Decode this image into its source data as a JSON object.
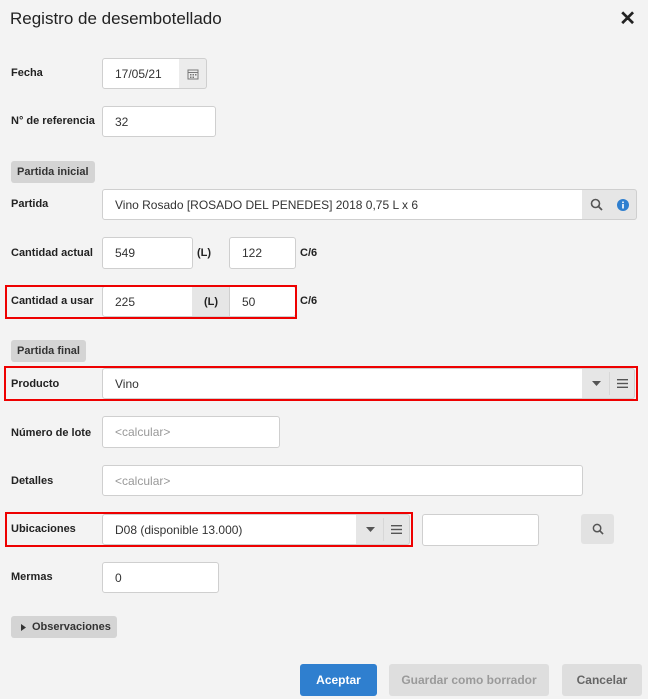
{
  "dialog": {
    "title": "Registro de desembotellado",
    "close_icon": "close-icon"
  },
  "fields": {
    "fecha": {
      "label": "Fecha",
      "value": "17/05/21"
    },
    "referencia": {
      "label": "N° de referencia",
      "value": "32"
    },
    "partida_inicial_tag": "Partida inicial",
    "partida": {
      "label": "Partida",
      "value": "Vino Rosado [ROSADO DEL PENEDES] 2018 0,75 L x 6"
    },
    "cantidad_actual": {
      "label": "Cantidad actual",
      "liters": "549",
      "liters_unit": "(L)",
      "boxes": "122",
      "boxes_unit": "C/6"
    },
    "cantidad_usar": {
      "label": "Cantidad a usar",
      "liters": "225",
      "liters_unit": "(L)",
      "boxes": "50",
      "boxes_unit": "C/6"
    },
    "partida_final_tag": "Partida final",
    "producto": {
      "label": "Producto",
      "value": "Vino"
    },
    "lote": {
      "label": "Número de lote",
      "placeholder": "<calcular>"
    },
    "detalles": {
      "label": "Detalles",
      "placeholder": "<calcular>"
    },
    "ubicaciones": {
      "label": "Ubicaciones",
      "value": "D08 (disponible 13.000)",
      "extra_value": ""
    },
    "mermas": {
      "label": "Mermas",
      "value": "0"
    },
    "observaciones": {
      "label": "Observaciones"
    }
  },
  "buttons": {
    "accept": "Aceptar",
    "draft": "Guardar como borrador",
    "cancel": "Cancelar"
  },
  "colors": {
    "primary": "#2f7fcf",
    "highlight": "#e00000",
    "info": "#2f7fcf"
  }
}
